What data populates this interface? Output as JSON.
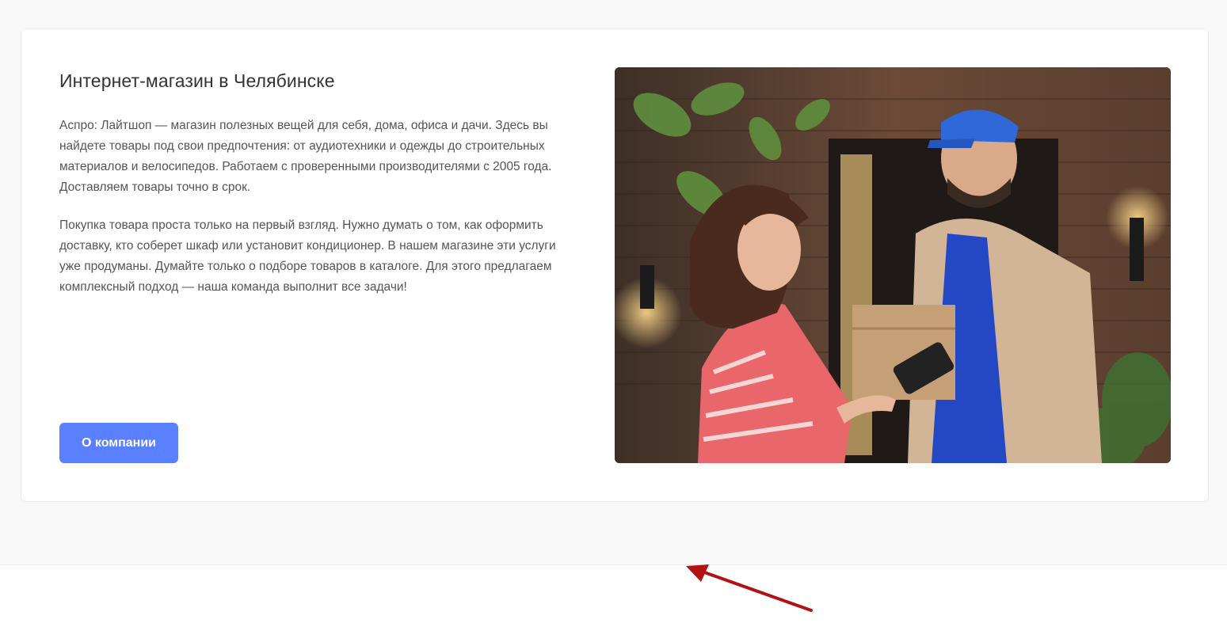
{
  "section": {
    "title": "Интернет-магазин в Челябинске",
    "paragraphs": [
      "Аспро: Лайтшоп — магазин полезных вещей для себя, дома, офиса и дачи. Здесь вы найдете товары под свои предпочтения: от аудиотехники и одежды до строительных материалов и велосипедов. Работаем с проверенными производителями с 2005 года. Доставляем товары точно в срок.",
      "Покупка товара проста только на первый взгляд. Нужно думать о том, как оформить доставку, кто соберет шкаф или установит кондиционер. В нашем магазине эти услуги уже продуманы. Думайте только о подборе товаров в каталоге. Для этого предлагаем комплексный подход — наша команда выполнит все задачи!"
    ],
    "button_label": "О компании",
    "image_alt": "Курьер в синей кепке передаёт коробку девушке, которая оплачивает картой через терминал"
  },
  "colors": {
    "page_background": "#f8f8f8",
    "card_background": "#ffffff",
    "accent": "#5b80ff",
    "annotation_arrow": "#b31212"
  }
}
